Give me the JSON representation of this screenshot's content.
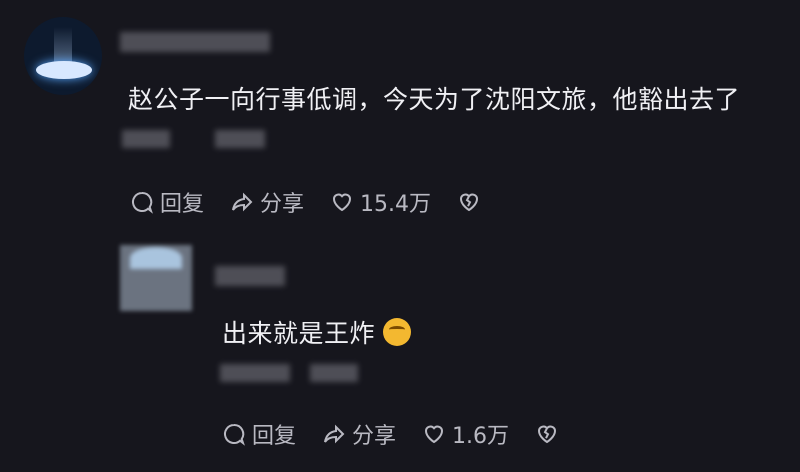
{
  "main_comment": {
    "text": "赵公子一向行事低调，今天为了沈阳文旅，他豁出去了",
    "actions": {
      "reply_label": "回复",
      "share_label": "分享",
      "like_count": "15.4万"
    }
  },
  "reply_comment": {
    "text": "出来就是王炸",
    "actions": {
      "reply_label": "回复",
      "share_label": "分享",
      "like_count": "1.6万"
    }
  }
}
